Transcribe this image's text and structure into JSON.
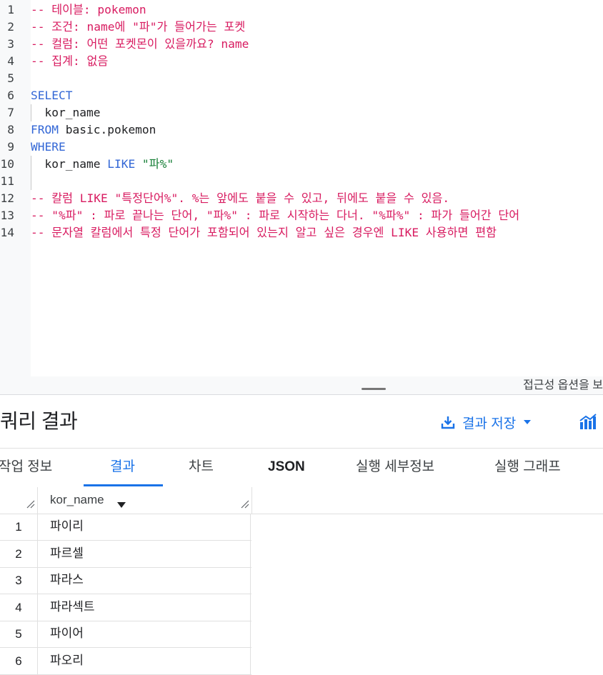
{
  "editor": {
    "lines": [
      {
        "num": "1",
        "segments": [
          {
            "t": "-- 테이블: pokemon",
            "k": "c-cmt"
          }
        ]
      },
      {
        "num": "2",
        "segments": [
          {
            "t": "-- 조건: name에 \"파\"가 들어가는 포켓",
            "k": "c-cmt"
          }
        ]
      },
      {
        "num": "3",
        "segments": [
          {
            "t": "-- 컬럼: 어떤 포켓몬이 있을까요? name",
            "k": "c-cmt"
          }
        ]
      },
      {
        "num": "4",
        "segments": [
          {
            "t": "-- 집계: 없음",
            "k": "c-cmt"
          }
        ]
      },
      {
        "num": "5",
        "segments": []
      },
      {
        "num": "6",
        "segments": [
          {
            "t": "SELECT",
            "k": "c-kw"
          }
        ]
      },
      {
        "num": "7",
        "segments": [
          {
            "t": "  kor_name",
            "k": "c-txt"
          }
        ]
      },
      {
        "num": "8",
        "segments": [
          {
            "t": "FROM",
            "k": "c-kw"
          },
          {
            "t": " basic.pokemon",
            "k": "c-txt"
          }
        ]
      },
      {
        "num": "9",
        "segments": [
          {
            "t": "WHERE",
            "k": "c-kw"
          }
        ]
      },
      {
        "num": "10",
        "segments": [
          {
            "t": "  kor_name ",
            "k": "c-txt"
          },
          {
            "t": "LIKE",
            "k": "c-kw"
          },
          {
            "t": " \"파%\"",
            "k": "c-str"
          }
        ]
      },
      {
        "num": "11",
        "segments": []
      },
      {
        "num": "12",
        "segments": [
          {
            "t": "-- 칼럼 LIKE \"특정단어%\". %는 앞에도 붙을 수 있고, 뒤에도 붙을 수 있음.",
            "k": "c-cmt"
          }
        ]
      },
      {
        "num": "13",
        "segments": [
          {
            "t": "-- \"%파\" : 파로 끝나는 단어, \"파%\" : 파로 시작하는 다너. \"%파%\" : 파가 들어간 단어",
            "k": "c-cmt"
          }
        ]
      },
      {
        "num": "14",
        "segments": [
          {
            "t": "-- 문자열 칼럼에서 특정 단어가 포함되어 있는지 알고 싶은 경우엔 LIKE 사용하면 편함",
            "k": "c-cmt"
          }
        ]
      }
    ],
    "accessibility_hint": "접근성 옵션을 보"
  },
  "results": {
    "title": "쿼리 결과",
    "save_label": "결과 저장",
    "tabs": [
      {
        "label": "작업 정보",
        "active": false
      },
      {
        "label": "결과",
        "active": true
      },
      {
        "label": "차트",
        "active": false
      },
      {
        "label": "JSON",
        "active": false
      },
      {
        "label": "실행 세부정보",
        "active": false
      },
      {
        "label": "실행 그래프",
        "active": false
      }
    ],
    "table": {
      "column": "kor_name",
      "rows": [
        {
          "idx": "1",
          "kor_name": "파이리"
        },
        {
          "idx": "2",
          "kor_name": "파르셀"
        },
        {
          "idx": "3",
          "kor_name": "파라스"
        },
        {
          "idx": "4",
          "kor_name": "파라섹트"
        },
        {
          "idx": "5",
          "kor_name": "파이어"
        },
        {
          "idx": "6",
          "kor_name": "파오리"
        }
      ]
    }
  },
  "colors": {
    "accent": "#1a73e8",
    "comment": "#d81b60",
    "keyword": "#3367d6",
    "string": "#188038"
  }
}
